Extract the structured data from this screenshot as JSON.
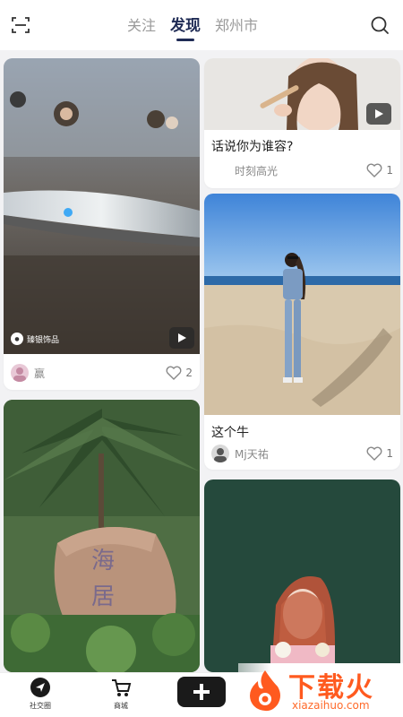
{
  "header": {
    "tabs": [
      {
        "label": "关注",
        "active": false
      },
      {
        "label": "发现",
        "active": true
      },
      {
        "label": "郑州市",
        "active": false
      }
    ]
  },
  "feed": {
    "cards": [
      {
        "id": "card1",
        "has_video": true,
        "watermark": "臻银饰品",
        "author": "赢",
        "likes": "2"
      },
      {
        "id": "card2",
        "has_video": true,
        "title": "话说你为谁容?",
        "author": "时刻高光",
        "likes": "1"
      },
      {
        "id": "card3",
        "title": "这个牛",
        "author": "Mj天祐",
        "likes": "1"
      },
      {
        "id": "card4",
        "caption_stone": "海 居"
      },
      {
        "id": "card5"
      }
    ]
  },
  "bottom_nav": {
    "items": [
      {
        "label": "社交圈",
        "icon": "send-icon"
      },
      {
        "label": "商城",
        "icon": "cart-icon"
      }
    ],
    "add_icon": "plus-icon"
  },
  "watermark": {
    "cn": "下载火",
    "en": "xiazaihuo.com"
  },
  "colors": {
    "accent": "#1f2b55",
    "brand": "#ff5a1f"
  }
}
